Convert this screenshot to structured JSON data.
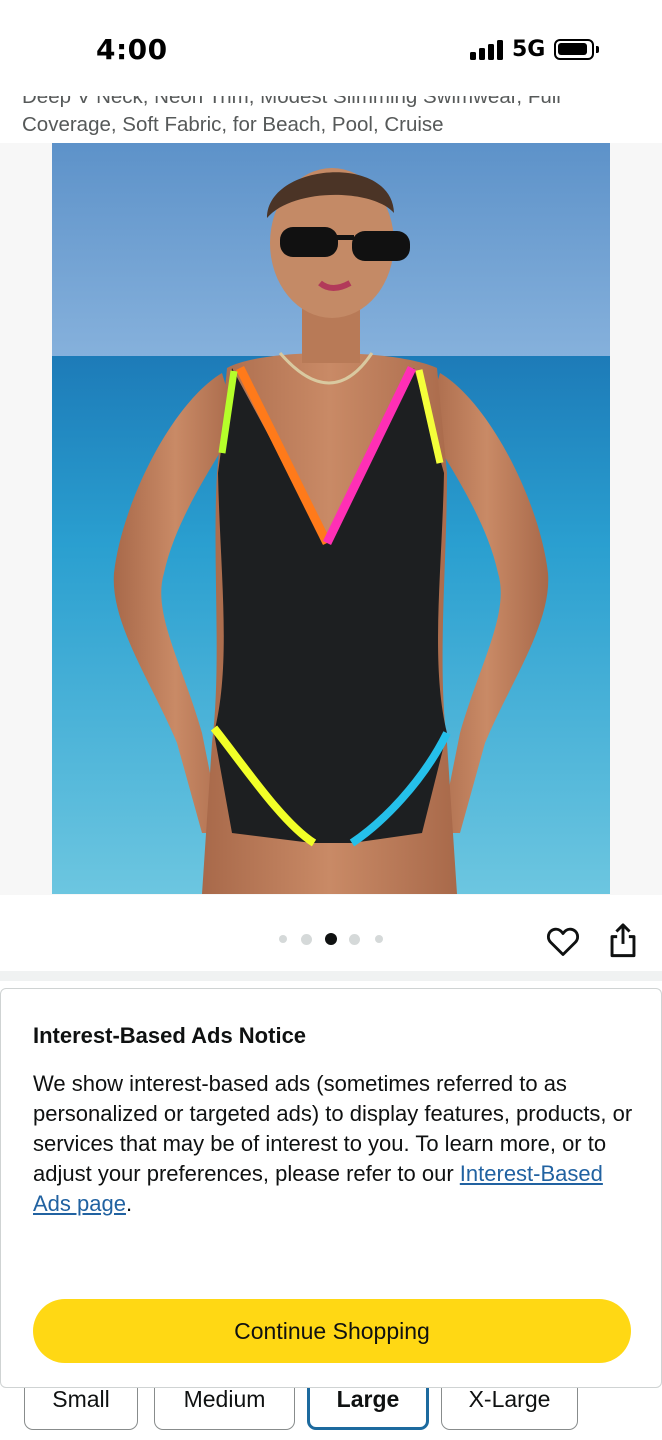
{
  "status_bar": {
    "time": "4:00",
    "network": "5G",
    "icons": [
      "cellular-signal-icon",
      "battery-icon"
    ]
  },
  "product": {
    "title_partial": "Deep V Neck, Neon Trim, Modest Slimming Swimwear, Full Coverage, Soft Fabric, for Beach, Pool, Cruise",
    "image": {
      "description": "Woman in a black one-piece swimsuit with neon trim on a beach",
      "count": 5,
      "active_index": 2
    },
    "actions": {
      "wishlist_icon": "heart-icon",
      "share_icon": "share-icon"
    }
  },
  "notice": {
    "title": "Interest-Based Ads Notice",
    "body_text": "We show interest-based ads (sometimes referred to as personalized or targeted ads) to display features, products, or services that may be of interest to you. To learn more, or to adjust your preferences, please refer to our ",
    "link_text": "Interest-Based Ads page",
    "body_end": ".",
    "continue_label": "Continue Shopping",
    "continue_color": "#FFD814",
    "link_color": "#2162A1"
  },
  "sizes": {
    "options": [
      "Small",
      "Medium",
      "Large",
      "X-Large"
    ],
    "selected": "Large",
    "selected_color": "#1C6A9E"
  }
}
